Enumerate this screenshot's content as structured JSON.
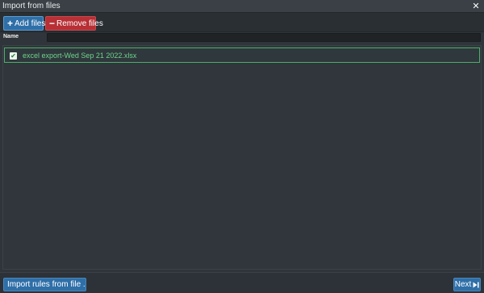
{
  "window": {
    "title": "Import from files",
    "close_icon": "close-icon"
  },
  "toolbar": {
    "add_label": "Add files",
    "add_icon": "plus-icon",
    "remove_label": "Remove files",
    "remove_icon": "minus-icon"
  },
  "filter": {
    "label": "Name",
    "value": "",
    "placeholder": ""
  },
  "files": [
    {
      "name": "excel export-Wed Sep 21 2022.xlsx",
      "checked": true
    }
  ],
  "footer": {
    "import_rules_label": "Import rules from file ...",
    "import_icon": "document-icon",
    "next_label": "Next",
    "next_icon": "skip-next-icon"
  },
  "colors": {
    "accent_blue": "#2f6fa8",
    "danger_red": "#b73035",
    "success_green": "#4caf6a",
    "background": "#2f353a"
  }
}
